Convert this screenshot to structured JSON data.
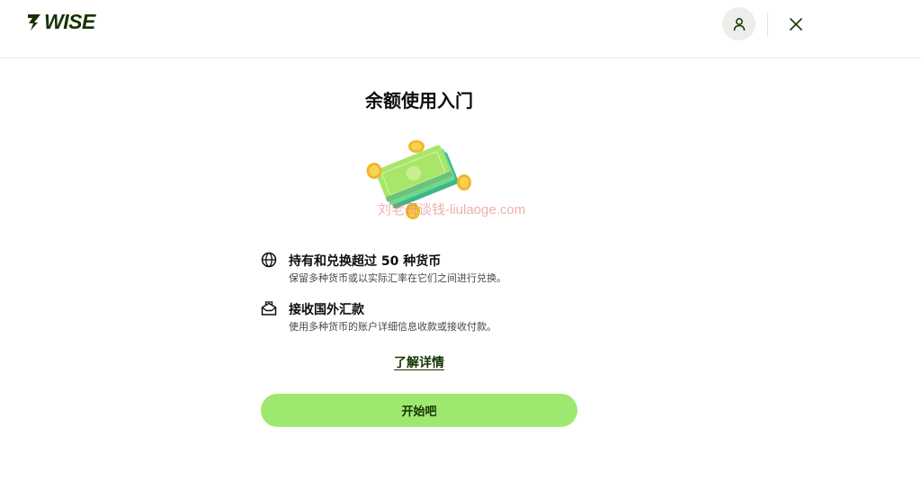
{
  "header": {
    "logo_text": "WISE",
    "account_icon": "person-icon",
    "close_icon": "close-icon"
  },
  "main": {
    "title": "余额使用入门",
    "illustration": "money-coins-illustration",
    "watermark": "刘老哥谈钱-liulaoge.com",
    "features": [
      {
        "icon": "globe-icon",
        "title": "持有和兑换超过 50 种货币",
        "description": "保留多种货币或以实际汇率在它们之间进行兑换。"
      },
      {
        "icon": "inbox-icon",
        "title": "接收国外汇款",
        "description": "使用多种货币的账户详细信息收款或接收付款。"
      }
    ],
    "learn_more_label": "了解详情",
    "start_button_label": "开始吧"
  },
  "colors": {
    "brand_dark": "#163300",
    "brand_green": "#9fe870",
    "text": "#0e0f0c",
    "muted_text": "#454745",
    "avatar_bg": "#ededeb"
  }
}
